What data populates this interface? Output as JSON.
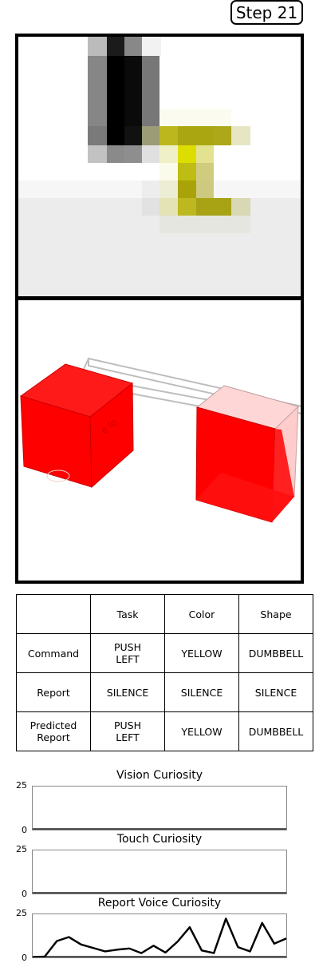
{
  "step_label": "Step 21",
  "table": {
    "header": [
      "",
      "Task",
      "Color",
      "Shape"
    ],
    "rows": [
      {
        "label": "Command",
        "task": "PUSH\nLEFT",
        "color": "YELLOW",
        "shape": "DUMBBELL"
      },
      {
        "label": "Report",
        "task": "SILENCE",
        "color": "SILENCE",
        "shape": "SILENCE"
      },
      {
        "label": "Predicted\nReport",
        "task": "PUSH\nLEFT",
        "color": "YELLOW",
        "shape": "DUMBBELL"
      }
    ]
  },
  "chart_data": [
    {
      "type": "line",
      "title": "Vision Curiosity",
      "ylim": [
        0,
        25
      ],
      "yticks": [
        "25",
        "0"
      ],
      "x": [],
      "values": []
    },
    {
      "type": "line",
      "title": "Touch Curiosity",
      "ylim": [
        0,
        25
      ],
      "yticks": [
        "25",
        "0"
      ],
      "x": [],
      "values": []
    },
    {
      "type": "line",
      "title": "Report Voice Curiosity",
      "ylim": [
        0,
        25
      ],
      "yticks": [
        "25",
        "0"
      ],
      "x": [
        0,
        1,
        2,
        3,
        4,
        5,
        6,
        7,
        8,
        9,
        10,
        11,
        12,
        13,
        14,
        15,
        16,
        17,
        18,
        19,
        20,
        21
      ],
      "values": [
        0.2,
        0.5,
        9.5,
        11.8,
        7.5,
        5.5,
        3.5,
        4.5,
        5.2,
        2.5,
        6.8,
        2.8,
        9.2,
        17.5,
        4.0,
        2.5,
        22.5,
        6.0,
        3.5,
        20.0,
        8.0,
        11.0
      ]
    }
  ]
}
